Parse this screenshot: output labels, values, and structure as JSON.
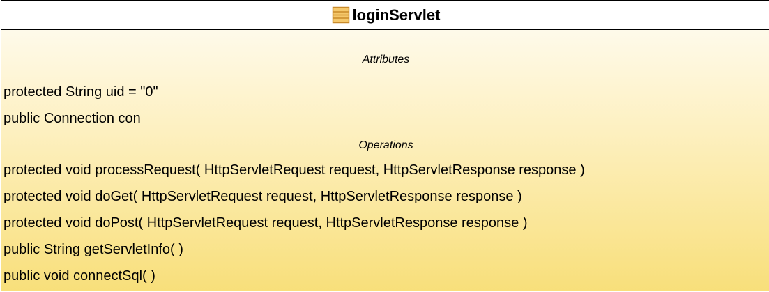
{
  "class": {
    "name": "loginServlet",
    "icon": "class-icon"
  },
  "attributes": {
    "title": "Attributes",
    "items": [
      "protected String uid = \"0\"",
      "public Connection con"
    ]
  },
  "operations": {
    "title": "Operations",
    "items": [
      "protected void  processRequest( HttpServletRequest request, HttpServletResponse response )",
      "protected void  doGet( HttpServletRequest request, HttpServletResponse response )",
      "protected void  doPost( HttpServletRequest request, HttpServletResponse response )",
      "public String  getServletInfo(  )",
      "public void  connectSql(  )"
    ]
  },
  "colors": {
    "border": "#000000",
    "header_bg": "#ffffff",
    "gradient_top": "#fffdf6",
    "gradient_bottom": "#f8df7a",
    "icon_fill": "#f5c86b",
    "icon_stroke": "#c98a2a"
  }
}
